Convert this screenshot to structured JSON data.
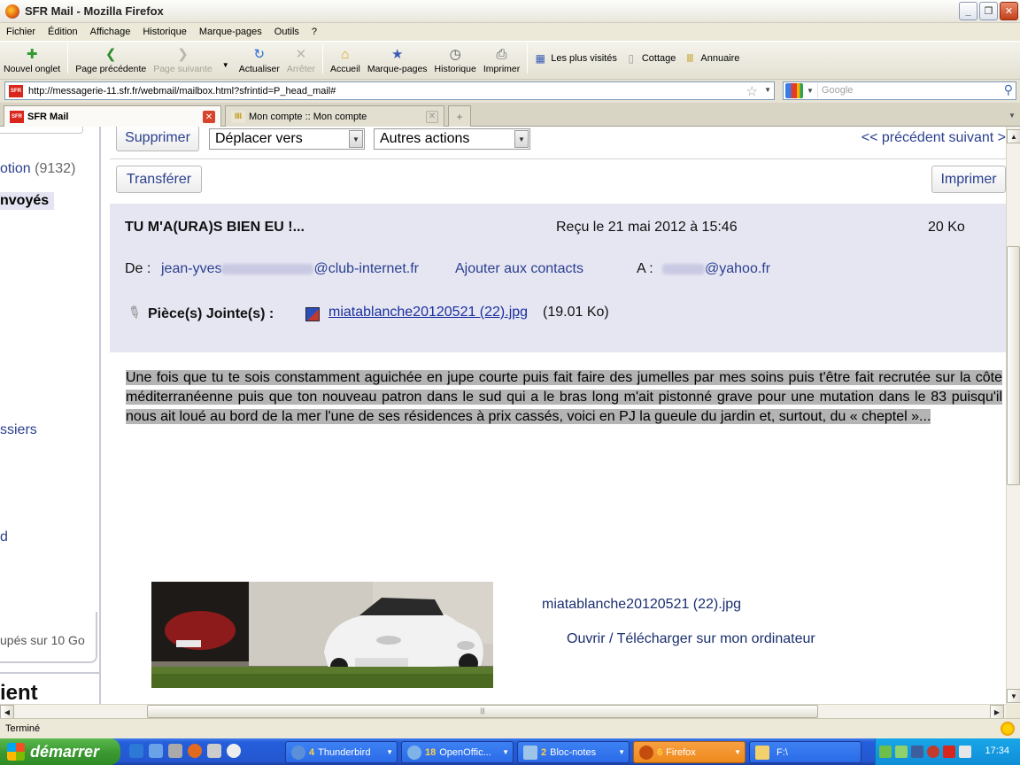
{
  "window": {
    "title": "SFR Mail - Mozilla Firefox"
  },
  "menu": [
    "Fichier",
    "Édition",
    "Affichage",
    "Historique",
    "Marque-pages",
    "Outils",
    "?"
  ],
  "toolbar": {
    "new_tab": "Nouvel onglet",
    "back": "Page précédente",
    "forward": "Page suivante",
    "reload": "Actualiser",
    "stop": "Arrêter",
    "home": "Accueil",
    "bookmarks": "Marque-pages",
    "history": "Historique",
    "print": "Imprimer"
  },
  "bookmarks_bar": [
    "Les plus visités",
    "Cottage",
    "Annuaire"
  ],
  "url": "http://messagerie-11.sfr.fr/webmail/mailbox.html?sfrintid=P_head_mail#",
  "search": {
    "placeholder": "Google"
  },
  "tabs": [
    {
      "label": "SFR Mail",
      "active": true
    },
    {
      "label": "Mon compte :: Mon compte",
      "active": false
    }
  ],
  "sidebar": {
    "folders": [
      {
        "label": "otion",
        "count": "(9132)"
      },
      {
        "label": "nvoyés",
        "selected": true
      },
      {
        "label": "ssiers"
      },
      {
        "label": "d"
      }
    ],
    "quota": "upés sur 10 Go",
    "client_label": "ient"
  },
  "mail": {
    "actions": {
      "delete": "Supprimer",
      "move": "Déplacer vers",
      "other": "Autres actions",
      "forward": "Transférer",
      "print": "Imprimer",
      "pager": "<< précédent suivant >"
    },
    "subject": "TU M'A(URA)S BIEN EU !...",
    "received": "Reçu le 21 mai 2012 à 15:46",
    "size": "20 Ko",
    "from_label": "De :",
    "from_start": "jean-yves",
    "from_end": "@club-internet.fr",
    "add_contact": "Ajouter aux contacts",
    "to_label": "A :",
    "to_end": "@yahoo.fr",
    "attachments_label": "Pièce(s) Jointe(s) :",
    "attachment_name": "miatablanche20120521 (22).jpg",
    "attachment_size": "(19.01 Ko)",
    "body": "Une fois que tu te sois constamment aguichée en jupe courte puis fait faire des jumelles par mes soins puis t'être fait recrutée sur la côte méditerranéenne puis que ton nouveau patron dans le sud qui a le bras long m'ait pistonné grave pour une mutation dans le 83 puisqu'il nous ait loué au bord de la mer l'une de ses résidences à prix cassés, voici en PJ la gueule du jardin et, surtout, du « cheptel »...",
    "image_caption": "miatablanche20120521 (22).jpg",
    "image_action": "Ouvrir / Télécharger sur mon ordinateur"
  },
  "status": "Terminé",
  "taskbar": {
    "start": "démarrer",
    "items": [
      {
        "count": "4",
        "label": "Thunderbird"
      },
      {
        "count": "18",
        "label": "OpenOffic..."
      },
      {
        "count": "2",
        "label": "Bloc-notes"
      },
      {
        "count": "6",
        "label": "Firefox",
        "active": true
      },
      {
        "count": "",
        "label": "F:\\"
      }
    ],
    "clock": "17:34"
  }
}
